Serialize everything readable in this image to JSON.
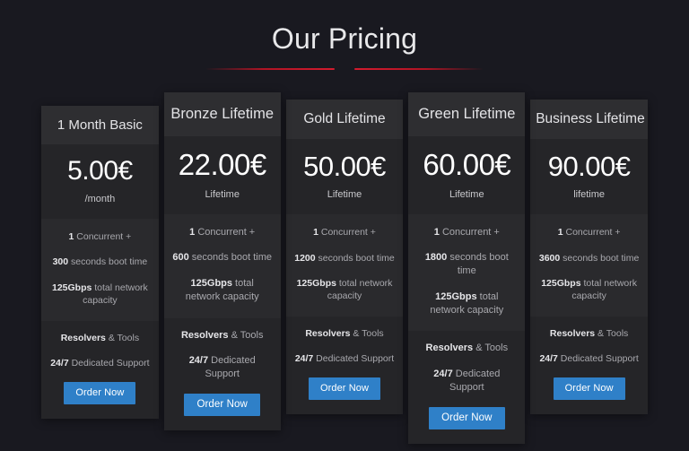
{
  "header": {
    "title": "Our Pricing"
  },
  "accent_colors": {
    "divider_red": "#d41b2e",
    "button_blue": "#2f80c8",
    "page_background": "#191920",
    "card_background": "#232326",
    "card_header_background": "#2e2e31"
  },
  "plans": [
    {
      "name": "1 Month Basic",
      "price": "5.00€",
      "period": "/month",
      "features": [
        {
          "strong": "1",
          "rest": " Concurrent +"
        },
        {
          "strong": "300",
          "rest": " seconds boot time"
        },
        {
          "strong": "125Gbps",
          "rest": " total network capacity"
        }
      ],
      "footer": [
        {
          "strong": "Resolvers",
          "rest": " & Tools"
        },
        {
          "strong": "24/7",
          "rest": " Dedicated Support"
        }
      ],
      "cta": "Order Now"
    },
    {
      "name": "Bronze Lifetime",
      "price": "22.00€",
      "period": "Lifetime",
      "features": [
        {
          "strong": "1",
          "rest": " Concurrent +"
        },
        {
          "strong": "600",
          "rest": " seconds boot time"
        },
        {
          "strong": "125Gbps",
          "rest": " total network capacity"
        }
      ],
      "footer": [
        {
          "strong": "Resolvers",
          "rest": " & Tools"
        },
        {
          "strong": "24/7",
          "rest": " Dedicated Support"
        }
      ],
      "cta": "Order Now"
    },
    {
      "name": "Gold Lifetime",
      "price": "50.00€",
      "period": "Lifetime",
      "features": [
        {
          "strong": "1",
          "rest": " Concurrent +"
        },
        {
          "strong": "1200",
          "rest": " seconds boot time"
        },
        {
          "strong": "125Gbps",
          "rest": " total network capacity"
        }
      ],
      "footer": [
        {
          "strong": "Resolvers",
          "rest": " & Tools"
        },
        {
          "strong": "24/7",
          "rest": " Dedicated Support"
        }
      ],
      "cta": "Order Now"
    },
    {
      "name": "Green Lifetime",
      "price": "60.00€",
      "period": "Lifetime",
      "features": [
        {
          "strong": "1",
          "rest": " Concurrent +"
        },
        {
          "strong": "1800",
          "rest": " seconds boot time"
        },
        {
          "strong": "125Gbps",
          "rest": " total network capacity"
        }
      ],
      "footer": [
        {
          "strong": "Resolvers",
          "rest": " & Tools"
        },
        {
          "strong": "24/7",
          "rest": " Dedicated Support"
        }
      ],
      "cta": "Order Now"
    },
    {
      "name": "Business Lifetime",
      "price": "90.00€",
      "period": "lifetime",
      "features": [
        {
          "strong": "1",
          "rest": " Concurrent +"
        },
        {
          "strong": "3600",
          "rest": " seconds boot time"
        },
        {
          "strong": "125Gbps",
          "rest": " total network capacity"
        }
      ],
      "footer": [
        {
          "strong": "Resolvers",
          "rest": " & Tools"
        },
        {
          "strong": "24/7",
          "rest": " Dedicated Support"
        }
      ],
      "cta": "Order Now"
    }
  ]
}
